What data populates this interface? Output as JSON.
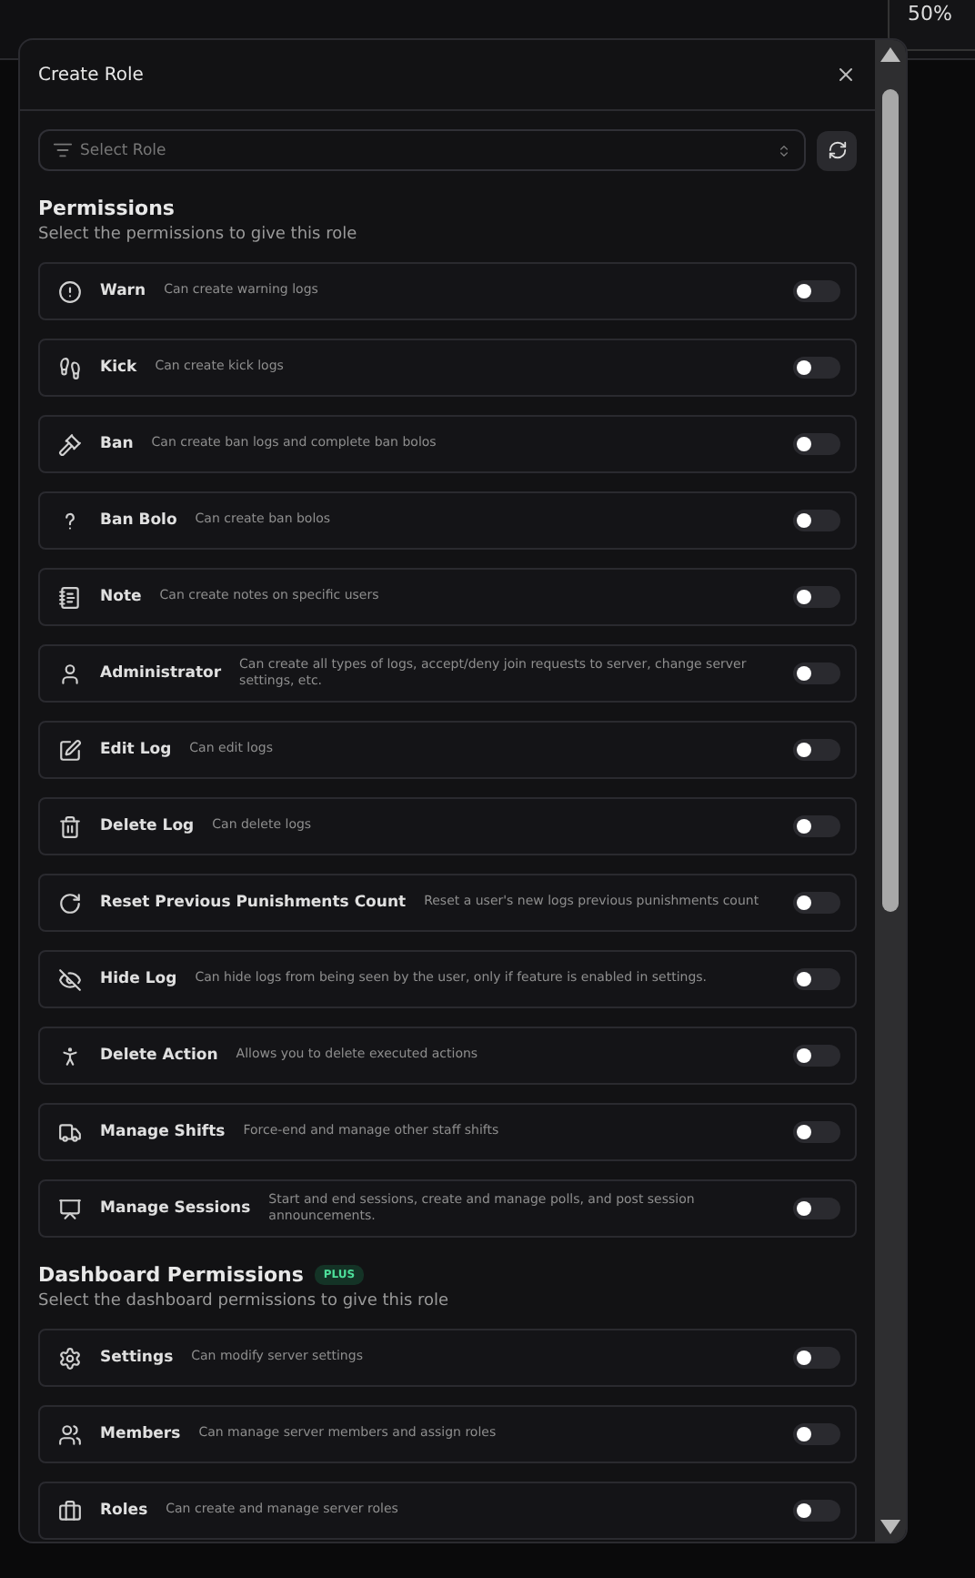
{
  "corner_card": {
    "text": "50%"
  },
  "dialog": {
    "title": "Create Role"
  },
  "role_select": {
    "placeholder": "Select Role"
  },
  "sections": [
    {
      "title": "Permissions",
      "subtitle": "Select the permissions to give this role",
      "permissions": [
        {
          "name": "Warn",
          "description": "Can create warning logs",
          "on": false
        },
        {
          "name": "Kick",
          "description": "Can create kick logs",
          "on": false
        },
        {
          "name": "Ban",
          "description": "Can create ban logs and complete ban bolos",
          "on": false
        },
        {
          "name": "Ban Bolo",
          "description": "Can create ban bolos",
          "on": false
        },
        {
          "name": "Note",
          "description": "Can create notes on specific users",
          "on": false
        },
        {
          "name": "Administrator",
          "description": "Can create all types of logs, accept/deny join requests to server, change server settings, etc.",
          "on": false
        },
        {
          "name": "Edit Log",
          "description": "Can edit logs",
          "on": false
        },
        {
          "name": "Delete Log",
          "description": "Can delete logs",
          "on": false
        },
        {
          "name": "Reset Previous Punishments Count",
          "description": "Reset a user's new logs previous punishments count",
          "on": false
        },
        {
          "name": "Hide Log",
          "description": "Can hide logs from being seen by the user, only if feature is enabled in settings.",
          "on": false
        },
        {
          "name": "Delete Action",
          "description": "Allows you to delete executed actions",
          "on": false
        },
        {
          "name": "Manage Shifts",
          "description": "Force-end and manage other staff shifts",
          "on": false
        },
        {
          "name": "Manage Sessions",
          "description": "Start and end sessions, create and manage polls, and post session announcements.",
          "on": false
        }
      ]
    },
    {
      "title": "Dashboard Permissions",
      "badge": "PLUS",
      "subtitle": "Select the dashboard permissions to give this role",
      "permissions": [
        {
          "name": "Settings",
          "description": "Can modify server settings",
          "on": false
        },
        {
          "name": "Members",
          "description": "Can manage server members and assign roles",
          "on": false
        },
        {
          "name": "Roles",
          "description": "Can create and manage server roles",
          "on": false
        }
      ]
    }
  ]
}
